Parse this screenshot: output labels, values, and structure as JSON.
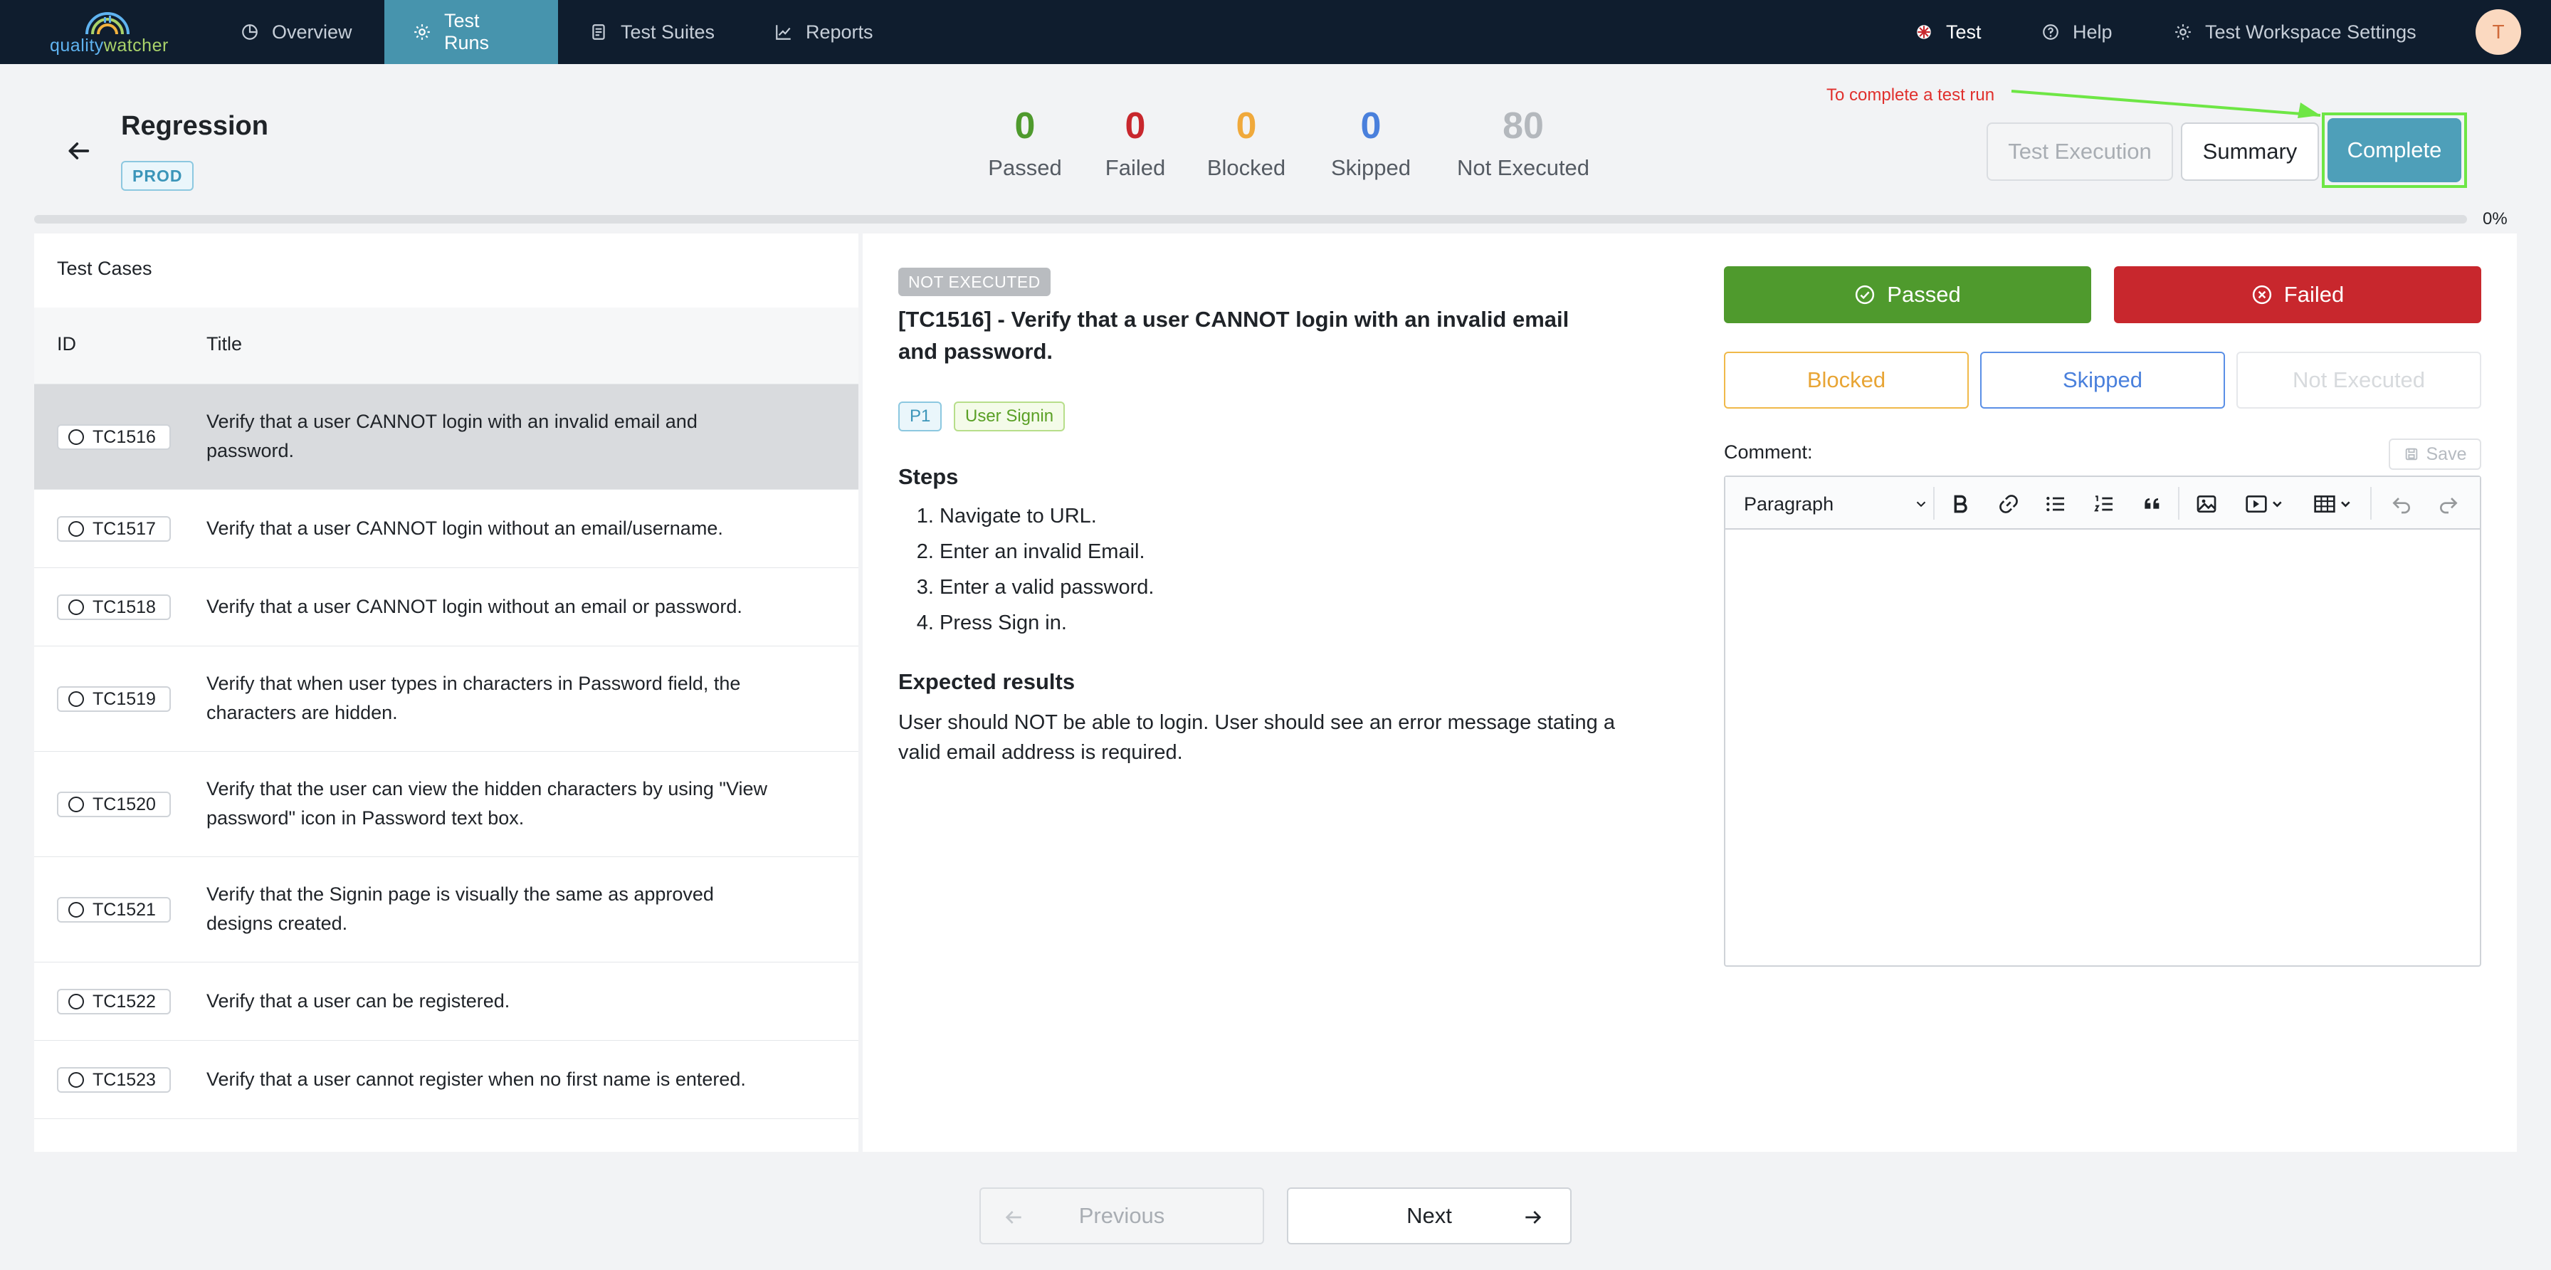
{
  "brand": {
    "logo_left": "quality",
    "logo_right": "watcher"
  },
  "nav": {
    "items": [
      {
        "label": "Overview",
        "icon": "pie-chart-icon"
      },
      {
        "label": "Test Runs",
        "icon": "gear-icon",
        "active": true
      },
      {
        "label": "Test Suites",
        "icon": "document-icon"
      },
      {
        "label": "Reports",
        "icon": "line-chart-icon"
      }
    ],
    "project": "Test",
    "help": "Help",
    "settings": "Test Workspace Settings",
    "avatar_initial": "T"
  },
  "run": {
    "title": "Regression",
    "env": "PROD"
  },
  "stats": [
    {
      "value": "0",
      "label": "Passed",
      "color": "#4f9a2d"
    },
    {
      "value": "0",
      "label": "Failed",
      "color": "#c8272d"
    },
    {
      "value": "0",
      "label": "Blocked",
      "color": "#f0a93b"
    },
    {
      "value": "0",
      "label": "Skipped",
      "color": "#4a80dc"
    },
    {
      "value": "80",
      "label": "Not Executed",
      "color": "#b4b8bd"
    }
  ],
  "annotation": "To complete a test run",
  "header_buttons": {
    "execution": "Test Execution",
    "summary": "Summary",
    "complete": "Complete"
  },
  "progress": {
    "percent": 0,
    "label": "0%"
  },
  "test_cases": {
    "heading": "Test Cases",
    "columns": {
      "id": "ID",
      "title": "Title"
    },
    "rows": [
      {
        "id": "TC1516",
        "title": "Verify that a user CANNOT login with an invalid email and password."
      },
      {
        "id": "TC1517",
        "title": "Verify that a user CANNOT login without an email/username."
      },
      {
        "id": "TC1518",
        "title": "Verify that a user CANNOT login without an email or password."
      },
      {
        "id": "TC1519",
        "title": "Verify that when user types in characters in Password field, the characters are hidden."
      },
      {
        "id": "TC1520",
        "title": "Verify that the user can view the hidden characters by using \"View password\" icon in Password text box."
      },
      {
        "id": "TC1521",
        "title": "Verify that the Signin page is visually the same as approved designs created."
      },
      {
        "id": "TC1522",
        "title": "Verify that a user can be registered."
      },
      {
        "id": "TC1523",
        "title": "Verify that a user cannot register when no first name is entered."
      }
    ]
  },
  "detail": {
    "status": "NOT EXECUTED",
    "title": "[TC1516] - Verify that a user CANNOT login with an invalid email and password.",
    "priority": "P1",
    "feature": "User Signin",
    "steps_heading": "Steps",
    "steps": [
      "Navigate to URL.",
      "Enter an invalid Email.",
      "Enter a valid password.",
      "Press Sign in."
    ],
    "expected_heading": "Expected results",
    "expected": "User should NOT be able to login. User should see an error message stating a valid email address is required."
  },
  "result_buttons": {
    "passed": "Passed",
    "failed": "Failed",
    "blocked": "Blocked",
    "skipped": "Skipped",
    "not_executed": "Not Executed"
  },
  "comment": {
    "label": "Comment:",
    "save": "Save",
    "paragraph": "Paragraph"
  },
  "pager": {
    "previous": "Previous",
    "next": "Next"
  }
}
